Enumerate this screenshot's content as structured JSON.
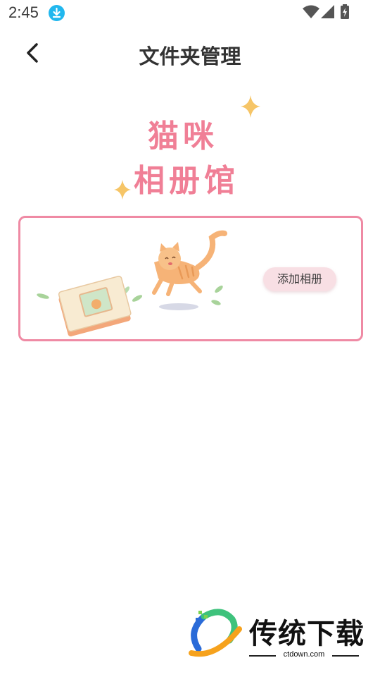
{
  "status_bar": {
    "time": "2:45",
    "icons": [
      "download-icon",
      "wifi-icon",
      "signal-icon",
      "battery-icon"
    ]
  },
  "header": {
    "title": "文件夹管理",
    "back_icon": "chevron-left-icon"
  },
  "logo": {
    "line1": "猫咪",
    "line2": "相册馆"
  },
  "album_card": {
    "button_label": "添加相册"
  },
  "watermark": {
    "name": "传统下载",
    "url": "ctdown.com"
  },
  "colors": {
    "accent_pink": "#ef8aa4",
    "logo_pink": "#f07f96",
    "button_bg": "#f8dfe4",
    "download_badge": "#21b7ee",
    "sparkle": "#f6c567"
  }
}
